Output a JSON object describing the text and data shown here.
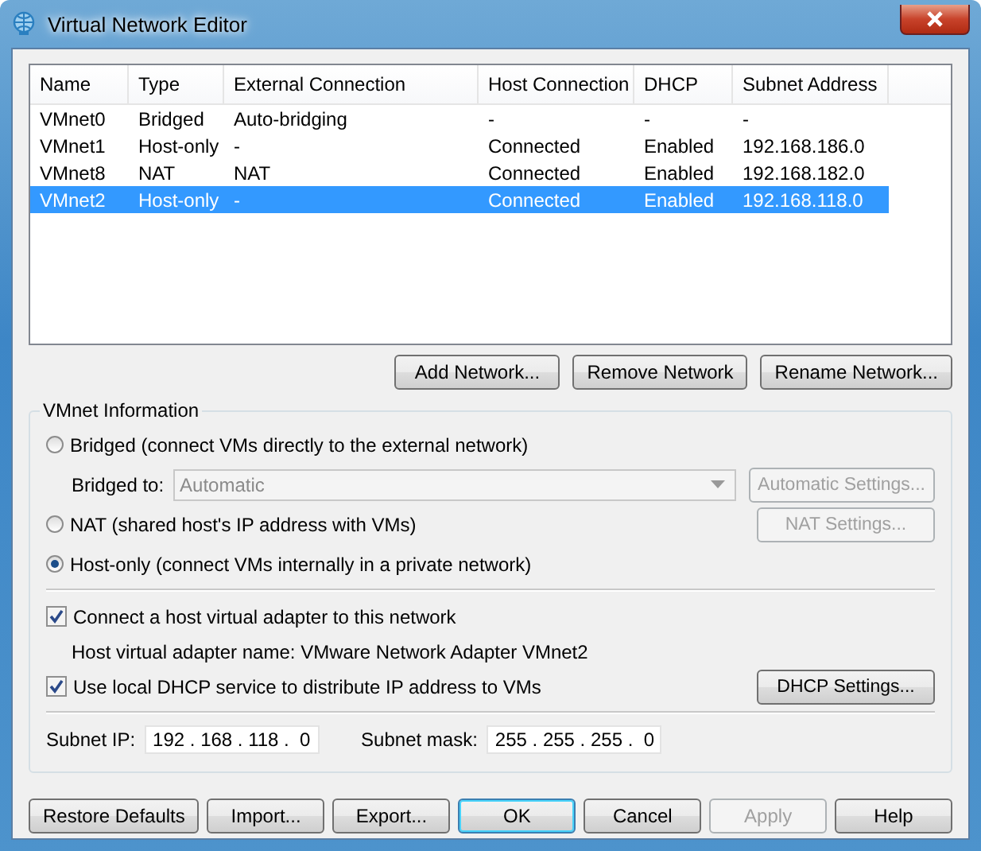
{
  "window": {
    "title": "Virtual Network Editor"
  },
  "table": {
    "columns": [
      "Name",
      "Type",
      "External Connection",
      "Host Connection",
      "DHCP",
      "Subnet Address"
    ],
    "rows": [
      {
        "cells": [
          "VMnet0",
          "Bridged",
          "Auto-bridging",
          "-",
          "-",
          "-"
        ],
        "selected": false
      },
      {
        "cells": [
          "VMnet1",
          "Host-only",
          "-",
          "Connected",
          "Enabled",
          "192.168.186.0"
        ],
        "selected": false
      },
      {
        "cells": [
          "VMnet8",
          "NAT",
          "NAT",
          "Connected",
          "Enabled",
          "192.168.182.0"
        ],
        "selected": false
      },
      {
        "cells": [
          "VMnet2",
          "Host-only",
          "-",
          "Connected",
          "Enabled",
          "192.168.118.0"
        ],
        "selected": true
      }
    ]
  },
  "network_buttons": [
    {
      "label": "Add Network...",
      "disabled": false
    },
    {
      "label": "Remove Network",
      "disabled": false
    },
    {
      "label": "Rename Network...",
      "disabled": false
    }
  ],
  "vmnet_info": {
    "title": "VMnet Information",
    "modes": [
      {
        "label": "Bridged (connect VMs directly to the external network)",
        "selected": false
      },
      {
        "label": "NAT (shared host's IP address with VMs)",
        "selected": false
      },
      {
        "label": "Host-only (connect VMs internally in a private network)",
        "selected": true
      }
    ],
    "bridged_to": {
      "label": "Bridged to:",
      "value": "Automatic",
      "disabled": true
    },
    "automatic_settings": {
      "label": "Automatic Settings...",
      "disabled": true
    },
    "nat_settings": {
      "label": "NAT Settings...",
      "disabled": true
    },
    "connect_adapter": {
      "label": "Connect a host virtual adapter to this network",
      "checked": true
    },
    "adapter_name": "Host virtual adapter name: VMware Network Adapter VMnet2",
    "use_dhcp": {
      "label": "Use local DHCP service to distribute IP address to VMs",
      "checked": true
    },
    "dhcp_settings": {
      "label": "DHCP Settings...",
      "disabled": false
    },
    "subnet_ip": {
      "label": "Subnet IP:",
      "value": "192 . 168 . 118 .  0"
    },
    "subnet_mask": {
      "label": "Subnet mask:",
      "value": "255 . 255 . 255 .  0"
    }
  },
  "buttons": [
    {
      "label": "Restore Defaults",
      "disabled": false,
      "default": false
    },
    {
      "label": "Import...",
      "disabled": false,
      "default": false
    },
    {
      "label": "Export...",
      "disabled": false,
      "default": false
    },
    {
      "label": "OK",
      "disabled": false,
      "default": true
    },
    {
      "label": "Cancel",
      "disabled": false,
      "default": false
    },
    {
      "label": "Apply",
      "disabled": true,
      "default": false
    },
    {
      "label": "Help",
      "disabled": false,
      "default": false
    }
  ]
}
